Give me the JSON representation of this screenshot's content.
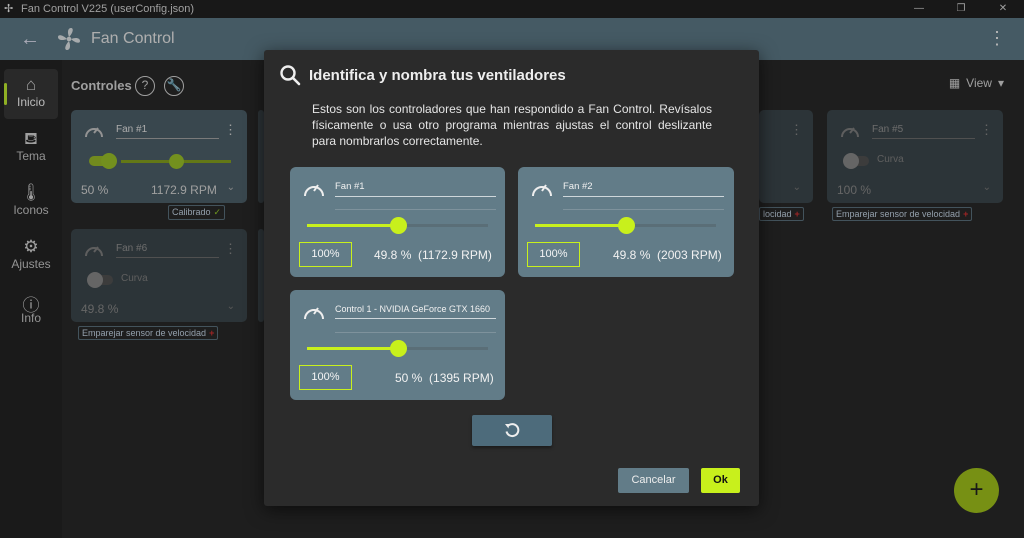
{
  "window": {
    "title": "Fan Control V225 (userConfig.json)"
  },
  "header": {
    "title": "Fan Control"
  },
  "sidebar": {
    "items": [
      {
        "label": "Inicio",
        "icon": "home-icon"
      },
      {
        "label": "Tema",
        "icon": "paint-bucket-icon"
      },
      {
        "label": "Iconos",
        "icon": "thermometer-icon"
      },
      {
        "label": "Ajustes",
        "icon": "gear-icon"
      },
      {
        "label": "Info",
        "icon": "info-icon"
      }
    ]
  },
  "main": {
    "section_title": "Controles",
    "view_label": "View",
    "cards": [
      {
        "name": "Fan #1",
        "percent": "50 %",
        "rpm": "1172.9 RPM",
        "tag": "Calibrado"
      },
      {
        "name": "Fan #5",
        "mode": "Curva",
        "percent": "100 %",
        "tag": "Emparejar sensor de velocidad"
      },
      {
        "name": "Fan #6",
        "mode": "Curva",
        "percent": "49.8 %",
        "tag": "Emparejar sensor de velocidad"
      },
      {
        "tag_partial": "locidad"
      }
    ]
  },
  "dialog": {
    "title": "Identifica y nombra tus ventiladores",
    "description": "Estos son los controladores que han respondido a Fan Control. Revísalos físicamente o usa otro programa mientras ajustas el control deslizante para nombrarlos correctamente.",
    "fans": [
      {
        "name": "Fan #1",
        "button": "100%",
        "slider_value": 0.5,
        "percent": "49.8 %",
        "rpm": "(1172.9 RPM)"
      },
      {
        "name": "Fan #2",
        "button": "100%",
        "slider_value": 0.5,
        "percent": "49.8 %",
        "rpm": "(2003 RPM)"
      },
      {
        "name": "Control 1 - NVIDIA GeForce GTX 1660",
        "button": "100%",
        "slider_value": 0.5,
        "percent": "50 %",
        "rpm": "(1395 RPM)"
      }
    ],
    "cancel_label": "Cancelar",
    "ok_label": "Ok"
  },
  "colors": {
    "accent": "#c8f01c",
    "header": "#607d8b",
    "card": "#627c88"
  }
}
